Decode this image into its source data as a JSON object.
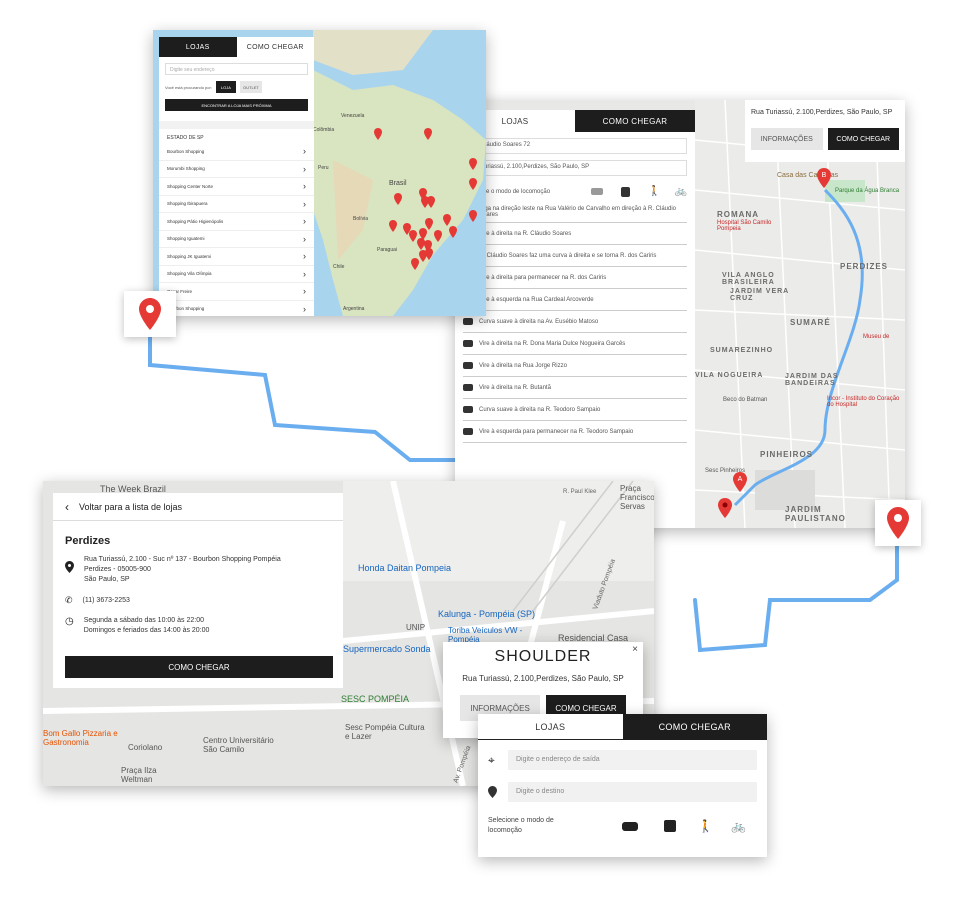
{
  "colors": {
    "route": "#6aaef0",
    "pin": "#e53935",
    "dark": "#1d1d1d"
  },
  "panel1": {
    "tabs": [
      "LOJAS",
      "COMO CHEGAR"
    ],
    "search_placeholder": "Digite seu endereço",
    "filter_text": "Você está procurando por:",
    "filter_store": "LOJA",
    "filter_outlet": "OUTLET",
    "find_nearest": "ENCONTRAR A LOJA MAIS PRÓXIMA",
    "state": "ESTADO DE SP",
    "stores": [
      "Bourbon Shopping",
      "Morumbi Shopping",
      "Shopping Center Norte",
      "Shopping Ibirapuera",
      "Shopping Pátio Higienópolis",
      "Shopping Iguatemi",
      "Shopping JK Iguatemi",
      "Shopping Vila Olímpia",
      "Oscar Freire",
      "Bourbon Shopping"
    ],
    "map_labels": [
      "Venezuela",
      "Colômbia",
      "Brasil",
      "Bolívia",
      "Paraguai",
      "Chile",
      "Argentina",
      "Peru"
    ]
  },
  "panel2": {
    "tabs": [
      "LOJAS",
      "COMO CHEGAR"
    ],
    "origin": "Rua Cláudio Soares 72",
    "destination": "Rua Turiassú, 2.100,Perdizes, São Paulo, SP",
    "mode_label": "Selecione o modo de locomoção",
    "steps": [
      "Siga na direção leste na Rua Valério de Carvalho em direção à R. Cláudio Soares",
      "Vire à direita na R. Cláudio Soares",
      "R. Cláudio Soares faz uma curva à direita e se torna R. dos Cariris",
      "Vire à direita para permanecer na R. dos Cariris",
      "Vire à esquerda na Rua Cardeal Arcoverde",
      "Curva suave à direita na Av. Eusébio Matoso",
      "Vire à direita na R. Dona Maria Dulce Nogueira Garcês",
      "Vire à direita na Rua Jorge Rizzo",
      "Vire à direita na R. Butantã",
      "Curva suave à direita na R. Teodoro Sampaio",
      "Vire à esquerda para permanecer na R. Teodoro Sampaio"
    ],
    "address": "Rua Turiassú, 2.100,Perdizes, São Paulo, SP",
    "info_button": "INFORMAÇÕES",
    "directions_button": "COMO CHEGAR",
    "map_labels": [
      "ROMANA",
      "PERDIZES",
      "VILA ANGLO BRASILEIRA",
      "JARDIM VERA CRUZ",
      "SUMARÉ",
      "SUMAREZINHO",
      "VILA NOGUEIRA",
      "JARDIM DAS BANDEIRAS",
      "PINHEIROS",
      "JARDIM PAULISTANO"
    ],
    "poi_labels": [
      "Casa das Caldeiras",
      "Parque da Água Branca",
      "Hospital São Camilo Pompeia",
      "Museu de",
      "Beco do Batman",
      "Incor - Instituto do Coração do Hospital",
      "Sesc Pinheiros"
    ]
  },
  "panel3": {
    "back": "Voltar para a lista de lojas",
    "store_name": "Perdizes",
    "address_lines": [
      "Rua Turiassú, 2.100 - Suc nº 137 - Bourbon Shopping Pompéia",
      "Perdizes - 05005-900",
      "São Paulo, SP"
    ],
    "phone": "(11) 3673-2253",
    "hours_lines": [
      "Segunda a sábado das 10:00 às 22:00",
      "Domingos e feriados das 14:00 às 20:00"
    ],
    "directions_button": "COMO CHEGAR",
    "map_labels": [
      "The Week Brazil",
      "Praça Francisco Servas",
      "R. Paul Klee",
      "Honda Daitan Pompeia",
      "Kalunga - Pompéia (SP)",
      "UNIP",
      "Toriba Veículos VW - Pompéia",
      "Residencial Casa",
      "Supermercado Sonda",
      "SESC POMPÉIA",
      "Sesc Pompéia Cultura e Lazer",
      "Coriolano",
      "Centro Universitário São Camilo",
      "Praça Ilza Weltman",
      "Bom Gallo Pizzaria e Gastronomia",
      "Viaduto Pompéia",
      "Av. Pompéia"
    ]
  },
  "popup": {
    "title": "SHOULDER",
    "address": "Rua Turiassú, 2.100,Perdizes, São Paulo, SP",
    "info_button": "INFORMAÇÕES",
    "directions_button": "COMO CHEGAR",
    "close": "×"
  },
  "panel4": {
    "tabs": [
      "LOJAS",
      "COMO CHEGAR"
    ],
    "origin_placeholder": "Digite o endereço de saída",
    "destination_placeholder": "Digite o destino",
    "mode_label": "Selecione o modo de locomoção"
  }
}
